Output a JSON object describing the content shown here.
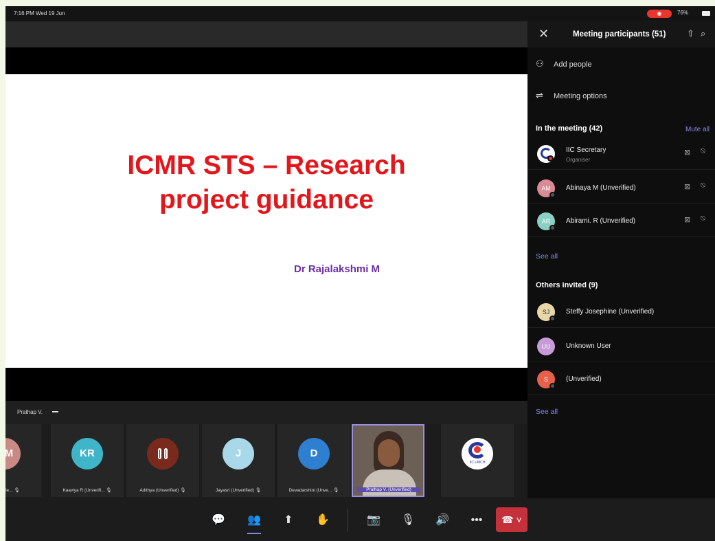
{
  "status_bar": {
    "time": "7:16 PM  Wed 19 Jun",
    "battery": "76%",
    "recording": "◉"
  },
  "slide": {
    "title_line1": "ICMR STS – Research",
    "title_line2": "project guidance",
    "author": "Dr Rajalakshmi M"
  },
  "gallery": {
    "pinned_label": "Prathap V.",
    "tiles": [
      {
        "initials": "GM",
        "label": "(Unverifie... 🎙",
        "color": "#c98a86"
      },
      {
        "initials": "KR",
        "label": "Kaaviya R (Unverifi... 🎙",
        "color": "#3fb5c9"
      },
      {
        "initials": "",
        "label": "Adithya (Unverified) 🎙",
        "color": "#7a2a1c"
      },
      {
        "initials": "J",
        "label": "Jayasri (Unverified) 🎙",
        "color": "#a9d8e8"
      },
      {
        "initials": "D",
        "label": "Devadarshini (Unve... 🎙",
        "color": "#2f7fd0"
      },
      {
        "initials": "",
        "label": "Prathap V. (Unverified)",
        "color": ""
      },
      {
        "initials": "",
        "label": "",
        "color": "#ffffff"
      }
    ],
    "logo_text": "IIC UMCH"
  },
  "toolbar": {
    "chat": "💬",
    "people": "👥",
    "share": "⬆",
    "react": "✋",
    "camera": "📷",
    "mic": "🎙",
    "speaker": "🔊",
    "more": "•••",
    "hangup": "☎ ˅"
  },
  "panel": {
    "title": "Meeting participants (51)",
    "add_people": "Add people",
    "meeting_options": "Meeting options",
    "in_meeting": "In the meeting (42)",
    "mute_all": "Mute all",
    "see_all_1": "See all",
    "others_invited": "Others invited (9)",
    "see_all_2": "See all",
    "in_meeting_people": [
      {
        "name": "IIC Secretary",
        "role": "Organiser",
        "initials": "",
        "color": "#ffffff"
      },
      {
        "name": "Abinaya M (Unverified)",
        "role": "",
        "initials": "AM",
        "color": "#d98a92"
      },
      {
        "name": "Abirami. R (Unverified)",
        "role": "",
        "initials": "AR",
        "color": "#8ad0c4"
      }
    ],
    "invited_people": [
      {
        "name": "Steffy Josephine (Unverified)",
        "initials": "SJ",
        "color": "#e8d6a8"
      },
      {
        "name": "Unknown User",
        "initials": "UU",
        "color": "#c89ad8"
      },
      {
        "name": "(Unverified)",
        "initials": "S",
        "color": "#e8604a"
      }
    ]
  },
  "colors": {
    "accent": "#8a86e8",
    "slide_title": "#e3161b",
    "author": "#6b2fa5",
    "hangup": "#c4313b"
  }
}
